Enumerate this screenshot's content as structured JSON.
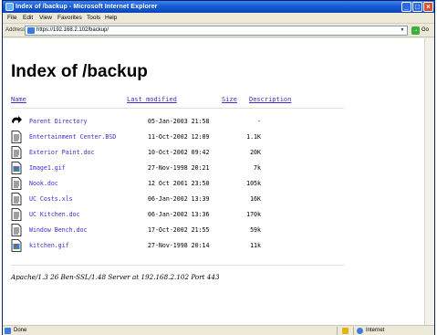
{
  "window": {
    "title": "Index of /backup - Microsoft Internet Explorer",
    "min": "_",
    "max": "□",
    "close": "×"
  },
  "menu": [
    "File",
    "Edit",
    "View",
    "Favorites",
    "Tools",
    "Help"
  ],
  "address": {
    "label": "Address",
    "url": "https://192.168.2.102/backup/",
    "go_label": "Go"
  },
  "page": {
    "heading": "Index of /backup",
    "columns": {
      "name": "Name",
      "last_modified": "Last modified",
      "size": "Size",
      "description": "Description"
    },
    "entries": [
      {
        "icon": "back-arrow-icon",
        "name": "Parent Directory",
        "date": "05-Jan-2003 21:58",
        "size": "-"
      },
      {
        "icon": "text-file-icon",
        "name": "Entertainment Center.BSD",
        "date": "11-Oct-2002 12:09",
        "size": "1.1K"
      },
      {
        "icon": "text-file-icon",
        "name": "Exterior Paint.doc",
        "date": "10-Oct-2002 09:42",
        "size": "20K"
      },
      {
        "icon": "image-file-icon",
        "name": "Image1.gif",
        "date": "27-Nov-1998 20:21",
        "size": "7k"
      },
      {
        "icon": "text-file-icon",
        "name": "Nook.doc",
        "date": "12 Oct 2001 23:50",
        "size": "105k"
      },
      {
        "icon": "text-file-icon",
        "name": "UC Costs.xls",
        "date": "06-Jan-2002 13:39",
        "size": "16K"
      },
      {
        "icon": "text-file-icon",
        "name": "UC Kitchen.doc",
        "date": "06-Jan-2002 13:36",
        "size": "170k"
      },
      {
        "icon": "text-file-icon",
        "name": "Window Bench.doc",
        "date": "17-Oct-2002 21:55",
        "size": "59k"
      },
      {
        "icon": "image-file-icon",
        "name": "kitchen.gif",
        "date": "27-Nov-1998 20:14",
        "size": "11k"
      }
    ],
    "server_signature": "Apache/1.3 26 Ben-SSL/1.48 Server at 192.168.2.102 Port 443"
  },
  "status": {
    "text": "Done",
    "zone": "Internet"
  },
  "colors": {
    "link": "#3b2fc9",
    "titlebar": "#1b5fd8"
  }
}
